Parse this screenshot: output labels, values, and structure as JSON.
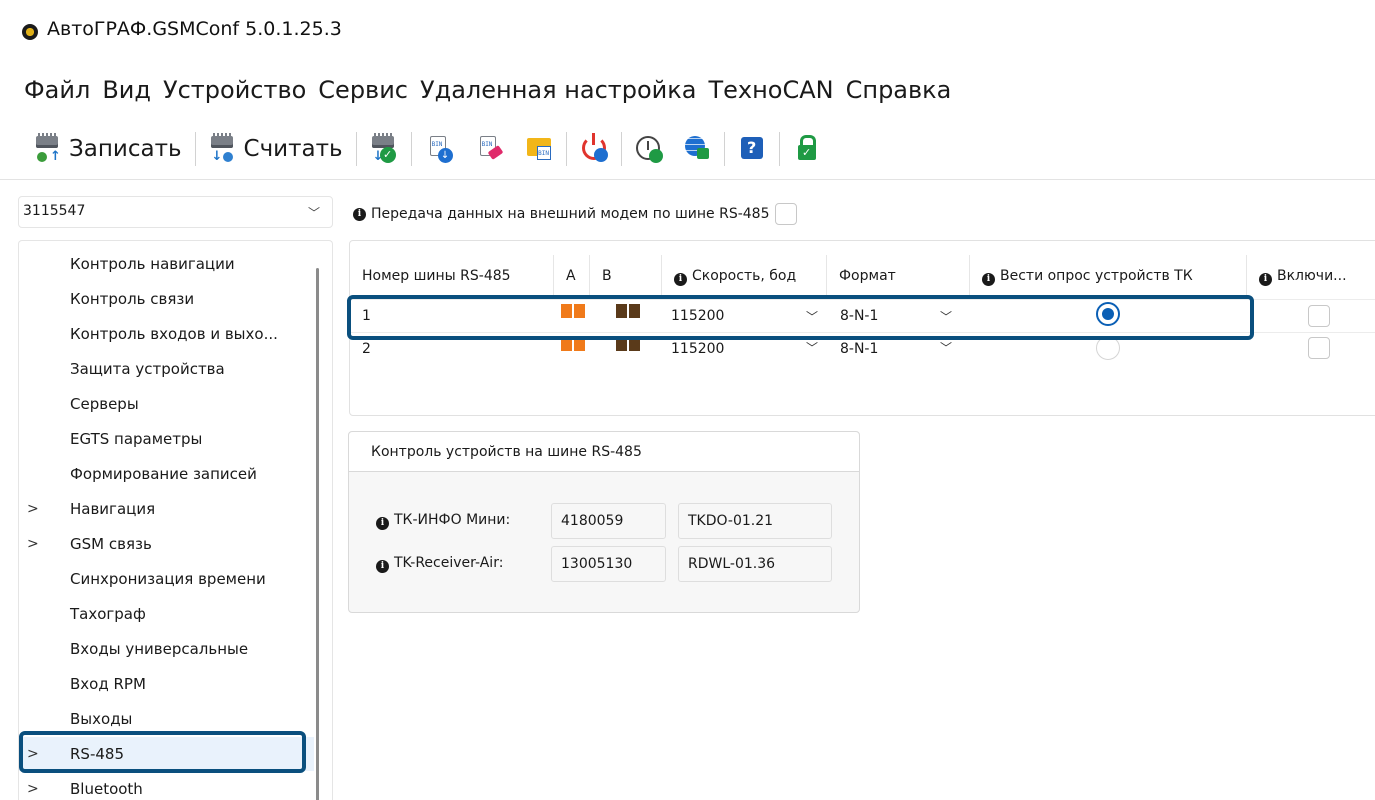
{
  "window": {
    "title": "АвтоГРАФ.GSMConf 5.0.1.25.3"
  },
  "menu": [
    "Файл",
    "Вид",
    "Устройство",
    "Сервис",
    "Удаленная настройка",
    "ТехноCAN",
    "Справка"
  ],
  "toolbar": {
    "write_label": "Записать",
    "read_label": "Считать",
    "icons": [
      "write-device-icon",
      "read-device-icon",
      "apply-config-icon",
      "download-bin-icon",
      "erase-bin-icon",
      "folder-bin-icon",
      "reboot-icon",
      "time-settings-icon",
      "remote-globe-icon",
      "help-icon",
      "unlock-icon"
    ]
  },
  "device": {
    "selected": "3115547"
  },
  "sidebar": {
    "items": [
      {
        "label": "Контроль навигации",
        "expandable": false
      },
      {
        "label": "Контроль связи",
        "expandable": false
      },
      {
        "label": "Контроль входов и выхо...",
        "expandable": false
      },
      {
        "label": "Защита устройства",
        "expandable": false
      },
      {
        "label": "Серверы",
        "expandable": false
      },
      {
        "label": "EGTS параметры",
        "expandable": false
      },
      {
        "label": "Формирование записей",
        "expandable": false
      },
      {
        "label": "Навигация",
        "expandable": true
      },
      {
        "label": "GSM связь",
        "expandable": true
      },
      {
        "label": "Синхронизация времени",
        "expandable": false
      },
      {
        "label": "Тахограф",
        "expandable": false
      },
      {
        "label": "Входы универсальные",
        "expandable": false
      },
      {
        "label": "Вход RPM",
        "expandable": false
      },
      {
        "label": "Выходы",
        "expandable": false
      },
      {
        "label": "RS-485",
        "expandable": true,
        "selected": true
      },
      {
        "label": "Bluetooth",
        "expandable": true
      }
    ]
  },
  "modem": {
    "label": "Передача данных на внешний модем по шине RS-485",
    "checked": false
  },
  "rs485_table": {
    "headers": [
      "Номер шины RS-485",
      "A",
      "B",
      "Скорость, бод",
      "Формат",
      "Вести опрос устройств ТК",
      "Включи..."
    ],
    "rows": [
      {
        "bus": "1",
        "speed": "115200",
        "format": "8-N-1",
        "poll": true,
        "enabled": false
      },
      {
        "bus": "2",
        "speed": "115200",
        "format": "8-N-1",
        "poll": false,
        "enabled": false
      }
    ],
    "color_a": "#f07a1a",
    "color_b": "#5a3a1a"
  },
  "control_group": {
    "title": "Контроль устройств на шине RS-485",
    "devices": [
      {
        "label": "ТК-ИНФО Мини:",
        "serial": "4180059",
        "firmware": "TKDO-01.21"
      },
      {
        "label": "TK-Receiver-Air:",
        "serial": "13005130",
        "firmware": "RDWL-01.36"
      }
    ]
  },
  "colors": {
    "highlight": "#0a4f7e",
    "selection": "#e9f2fc",
    "radio_on": "#0a5fb5"
  }
}
